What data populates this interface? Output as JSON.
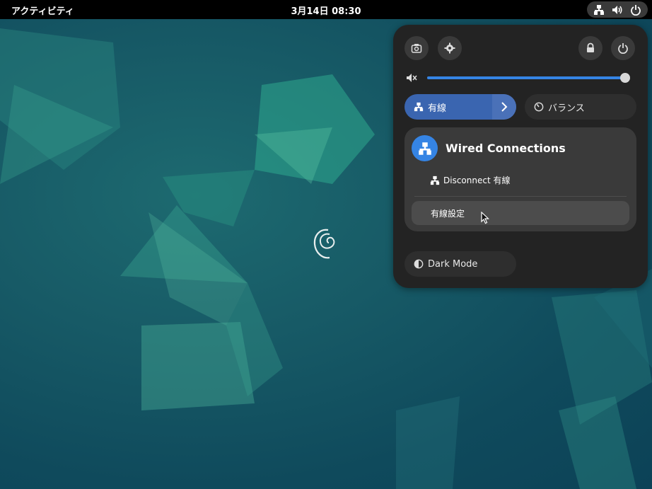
{
  "topbar": {
    "activities": "アクティビティ",
    "clock": "3月14日 08:30",
    "tray_icons": [
      "network-wired-icon",
      "volume-icon",
      "power-icon"
    ]
  },
  "quick_settings": {
    "top_buttons": [
      "screenshot-icon",
      "settings-icon",
      "lock-icon",
      "power-icon"
    ],
    "volume": {
      "level": 1.0,
      "icon": "volume-muted-icon"
    },
    "tiles": {
      "wired": {
        "label": "有線",
        "icon": "network-wired-icon",
        "active": true
      },
      "power_mode": {
        "label": "バランス",
        "icon": "power-profile-icon"
      }
    },
    "wired_menu": {
      "title": "Wired Connections",
      "items": [
        {
          "label": "Disconnect 有線",
          "icon": "network-wired-icon"
        }
      ],
      "settings_label": "有線設定"
    },
    "dark_mode": {
      "label": "Dark Mode",
      "icon": "dark-mode-icon"
    }
  },
  "colors": {
    "accent": "#3584e4",
    "active_tile": "#3a65b0",
    "panel_bg": "#232323"
  }
}
